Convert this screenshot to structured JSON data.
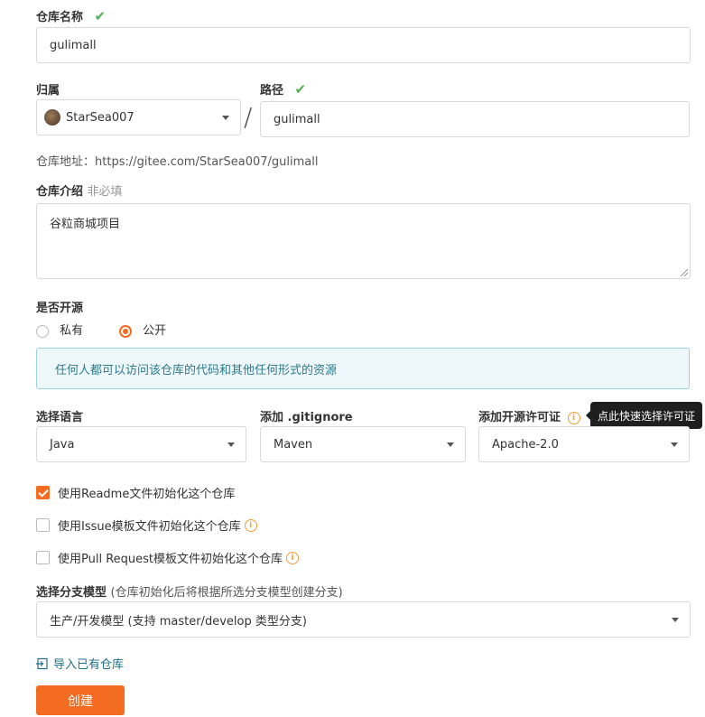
{
  "repo_name": {
    "label": "仓库名称",
    "value": "gulimall"
  },
  "owner": {
    "label": "归属",
    "selected": "StarSea007"
  },
  "path": {
    "label": "路径",
    "value": "gulimall",
    "separator": "/"
  },
  "repo_url": {
    "label": "仓库地址：",
    "url": "https://gitee.com/StarSea007/gulimall"
  },
  "description": {
    "label": "仓库介绍",
    "optional": "非必填",
    "value": "谷粒商城项目"
  },
  "visibility": {
    "label": "是否开源",
    "options": [
      {
        "label": "私有",
        "selected": false
      },
      {
        "label": "公开",
        "selected": true
      }
    ],
    "notice": "任何人都可以访问该仓库的代码和其他任何形式的资源"
  },
  "language": {
    "label": "选择语言",
    "selected": "Java"
  },
  "gitignore": {
    "label": "添加 .gitignore",
    "selected": "Maven"
  },
  "license": {
    "label": "添加开源许可证",
    "selected": "Apache-2.0",
    "tooltip": "点此快速选择许可证"
  },
  "init_options": [
    {
      "label": "使用Readme文件初始化这个仓库",
      "checked": true
    },
    {
      "label": "使用Issue模板文件初始化这个仓库",
      "checked": false
    },
    {
      "label": "使用Pull Request模板文件初始化这个仓库",
      "checked": false
    }
  ],
  "branch_model": {
    "label": "选择分支模型",
    "hint": "(仓库初始化后将根据所选分支模型创建分支)",
    "selected": "生产/开发模型 (支持 master/develop 类型分支)"
  },
  "import_link": "导入已有仓库",
  "create_button": "创建",
  "colors": {
    "accent": "#f36c21",
    "success": "#4caf50",
    "link": "#1f6f8b",
    "notice_bg": "#eef8fa",
    "notice_border": "#9ed1df"
  }
}
